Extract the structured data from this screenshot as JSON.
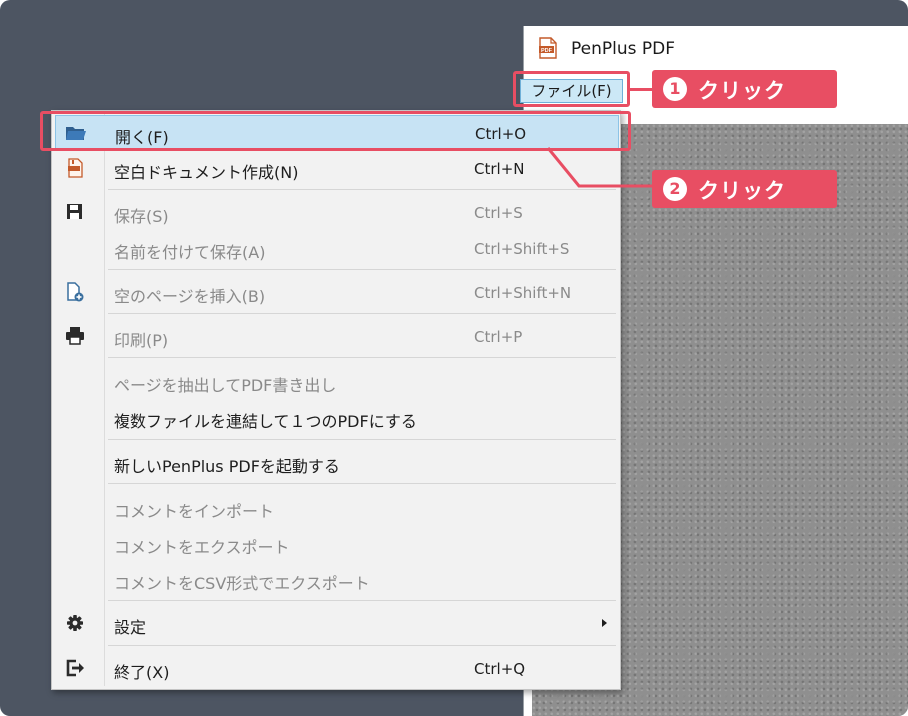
{
  "app": {
    "title": "PenPlus PDF",
    "menubar_file_label": "ファイル(F)"
  },
  "menu": {
    "items": [
      {
        "label": "開く(F)",
        "shortcut": "Ctrl+O",
        "icon": "folder-open-icon",
        "enabled": true,
        "highlighted": true
      },
      {
        "label": "空白ドキュメント作成(N)",
        "shortcut": "Ctrl+N",
        "icon": "new-pdf-icon",
        "enabled": true
      },
      {
        "label": "保存(S)",
        "shortcut": "Ctrl+S",
        "icon": "floppy-disk-icon",
        "enabled": false
      },
      {
        "label": "名前を付けて保存(A)",
        "shortcut": "Ctrl+Shift+S",
        "enabled": false
      },
      {
        "label": "空のページを挿入(B)",
        "shortcut": "Ctrl+Shift+N",
        "icon": "add-page-icon",
        "enabled": false
      },
      {
        "label": "印刷(P)",
        "shortcut": "Ctrl+P",
        "icon": "printer-icon",
        "enabled": false
      },
      {
        "label": "ページを抽出してPDF書き出し",
        "enabled": false
      },
      {
        "label": "複数ファイルを連結して１つのPDFにする",
        "enabled": true
      },
      {
        "label": "新しいPenPlus PDFを起動する",
        "enabled": true
      },
      {
        "label": "コメントをインポート",
        "enabled": false
      },
      {
        "label": "コメントをエクスポート",
        "enabled": false
      },
      {
        "label": "コメントをCSV形式でエクスポート",
        "enabled": false
      },
      {
        "label": "設定",
        "icon": "gear-icon",
        "enabled": true,
        "submenu": true
      },
      {
        "label": "終了(X)",
        "shortcut": "Ctrl+Q",
        "icon": "exit-icon",
        "enabled": true
      }
    ]
  },
  "annotations": {
    "step1": {
      "number": "1",
      "text": "クリック"
    },
    "step2": {
      "number": "2",
      "text": "クリック"
    },
    "color": "#e84e63"
  },
  "colors": {
    "background": "#4d5562",
    "menu_highlight": "#c7e3f4",
    "icon_blue": "#3a6f9e"
  }
}
